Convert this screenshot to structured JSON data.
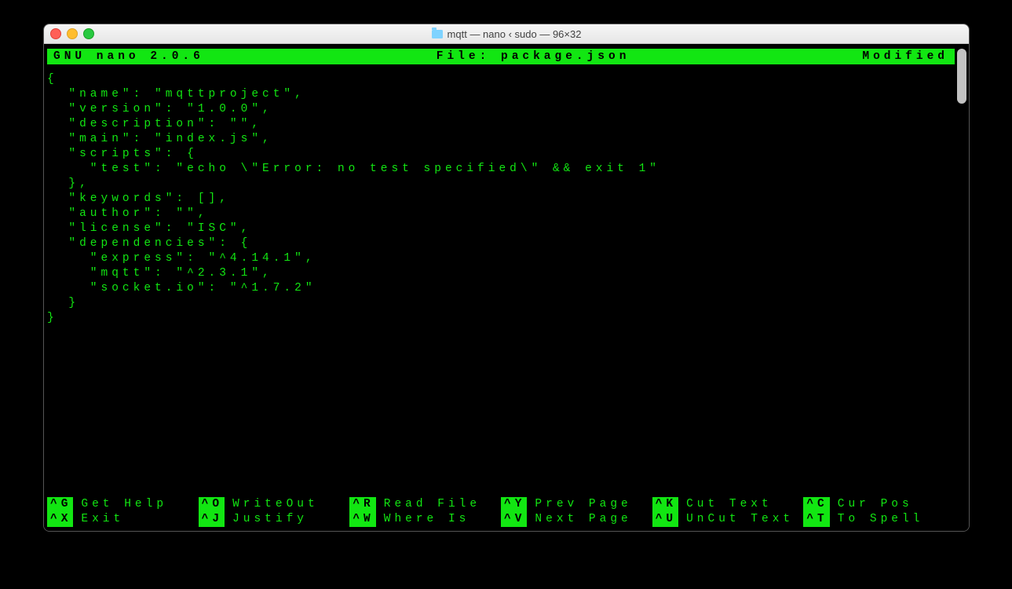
{
  "window": {
    "title": "mqtt — nano ‹ sudo — 96×32"
  },
  "header": {
    "app": "GNU nano 2.0.6",
    "file_label": "File: package.json",
    "status": "Modified"
  },
  "editor_lines": [
    "{",
    "  \"name\": \"mqttproject\",",
    "  \"version\": \"1.0.0\",",
    "  \"description\": \"\",",
    "  \"main\": \"index.js\",",
    "  \"scripts\": {",
    "    \"test\": \"echo \\\"Error: no test specified\\\" && exit 1\"",
    "  },",
    "  \"keywords\": [],",
    "  \"author\": \"\",",
    "  \"license\": \"ISC\",",
    "  \"dependencies\": {",
    "    \"express\": \"^4.14.1\",",
    "    \"mqtt\": \"^2.3.1\",",
    "    \"socket.io\": \"^1.7.2\"",
    "  }",
    "}"
  ],
  "shortcuts": {
    "row1": [
      {
        "key": "^G",
        "label": "Get Help"
      },
      {
        "key": "^O",
        "label": "WriteOut"
      },
      {
        "key": "^R",
        "label": "Read File"
      },
      {
        "key": "^Y",
        "label": "Prev Page"
      },
      {
        "key": "^K",
        "label": "Cut Text"
      },
      {
        "key": "^C",
        "label": "Cur Pos"
      }
    ],
    "row2": [
      {
        "key": "^X",
        "label": "Exit"
      },
      {
        "key": "^J",
        "label": "Justify"
      },
      {
        "key": "^W",
        "label": "Where Is"
      },
      {
        "key": "^V",
        "label": "Next Page"
      },
      {
        "key": "^U",
        "label": "UnCut Text"
      },
      {
        "key": "^T",
        "label": "To Spell"
      }
    ]
  }
}
